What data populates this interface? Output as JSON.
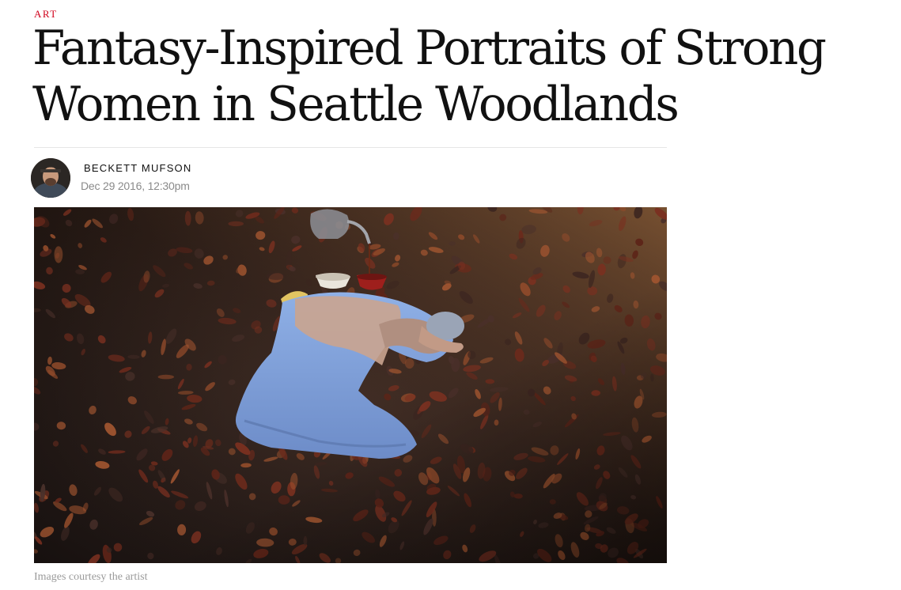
{
  "article": {
    "category": "ART",
    "headline": "Fantasy-Inspired Portraits of Strong Women in Seattle Woodlands",
    "author": "BECKETT MUFSON",
    "date": "Dec 29 2016, 12:30pm",
    "caption": "Images courtesy the artist"
  },
  "colors": {
    "category": "#d0021b",
    "meta_gray": "#8a8a8a",
    "caption_gray": "#9a9a9a",
    "dress_blue": "#7f9fd6"
  },
  "icons": {
    "avatar": "author-avatar"
  }
}
